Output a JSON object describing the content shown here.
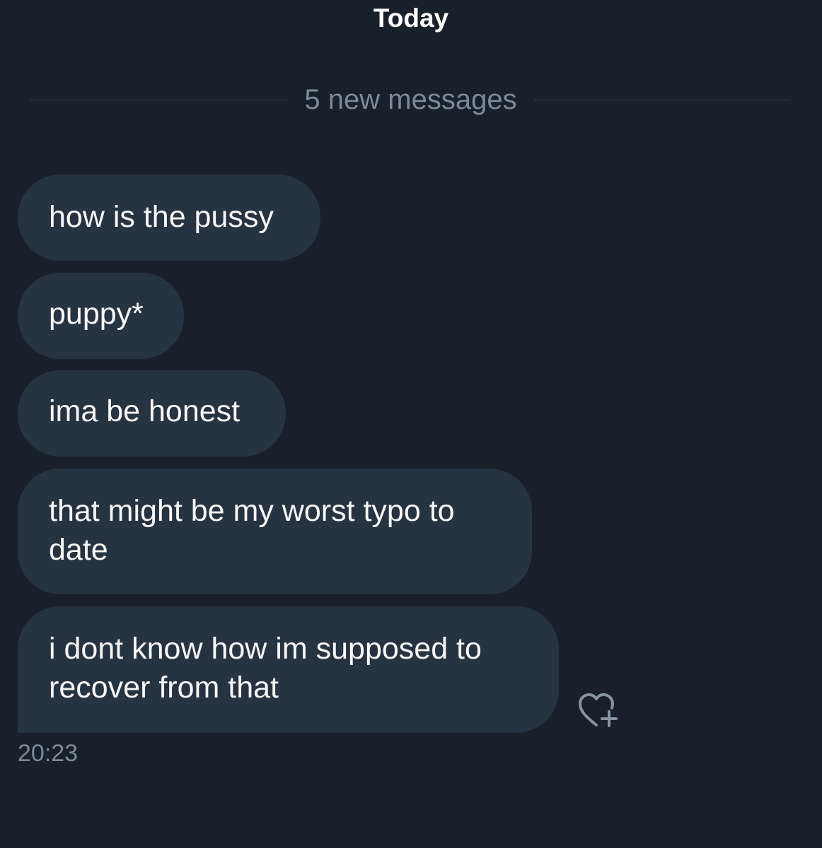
{
  "day_header": "Today",
  "new_messages_divider": "5 new messages",
  "messages": [
    {
      "text": "how is the pussy"
    },
    {
      "text": "puppy*"
    },
    {
      "text": "ima be honest"
    },
    {
      "text": "that might be my worst typo to date"
    },
    {
      "text": "i dont know how im supposed to recover from that"
    }
  ],
  "last_message_time": "20:23",
  "react_icon": "heart-plus-icon",
  "colors": {
    "background": "#17202b",
    "bubble": "#263340",
    "muted_text": "#7b8a99"
  }
}
